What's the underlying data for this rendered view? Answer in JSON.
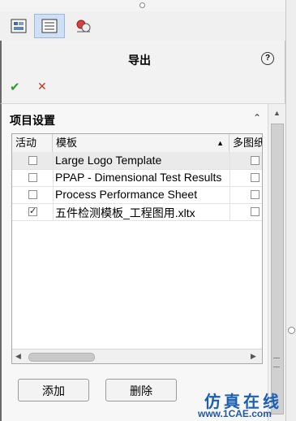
{
  "tabs": [
    {
      "icon": "feature-tree-icon"
    },
    {
      "icon": "property-manager-icon"
    },
    {
      "icon": "configuration-manager-icon"
    }
  ],
  "panel": {
    "title": "导出",
    "ok_icon": "✔",
    "cancel_icon": "✕",
    "help_icon": "?"
  },
  "section": {
    "title": "项目设置",
    "collapse_icon": "⌃"
  },
  "table": {
    "columns": [
      "活动",
      "模板",
      "多图纸"
    ],
    "sort_indicator": "▲",
    "rows": [
      {
        "active": false,
        "template": "Large Logo Template",
        "multi": false
      },
      {
        "active": false,
        "template": "PPAP - Dimensional Test Results",
        "multi": false
      },
      {
        "active": false,
        "template": "Process Performance Sheet",
        "multi": false
      },
      {
        "active": true,
        "template": "五件检测模板_工程图用.xltx",
        "multi": false
      }
    ]
  },
  "buttons": {
    "add": "添加",
    "delete": "删除"
  },
  "watermark": {
    "line1": "仿真在线",
    "line2": "www.1CAE.com"
  },
  "colors": {
    "ok_green": "#2f9a2f",
    "cancel_red": "#c0392b",
    "active_tab": "#cfe0f4",
    "watermark_blue": "#1a5fb4"
  }
}
